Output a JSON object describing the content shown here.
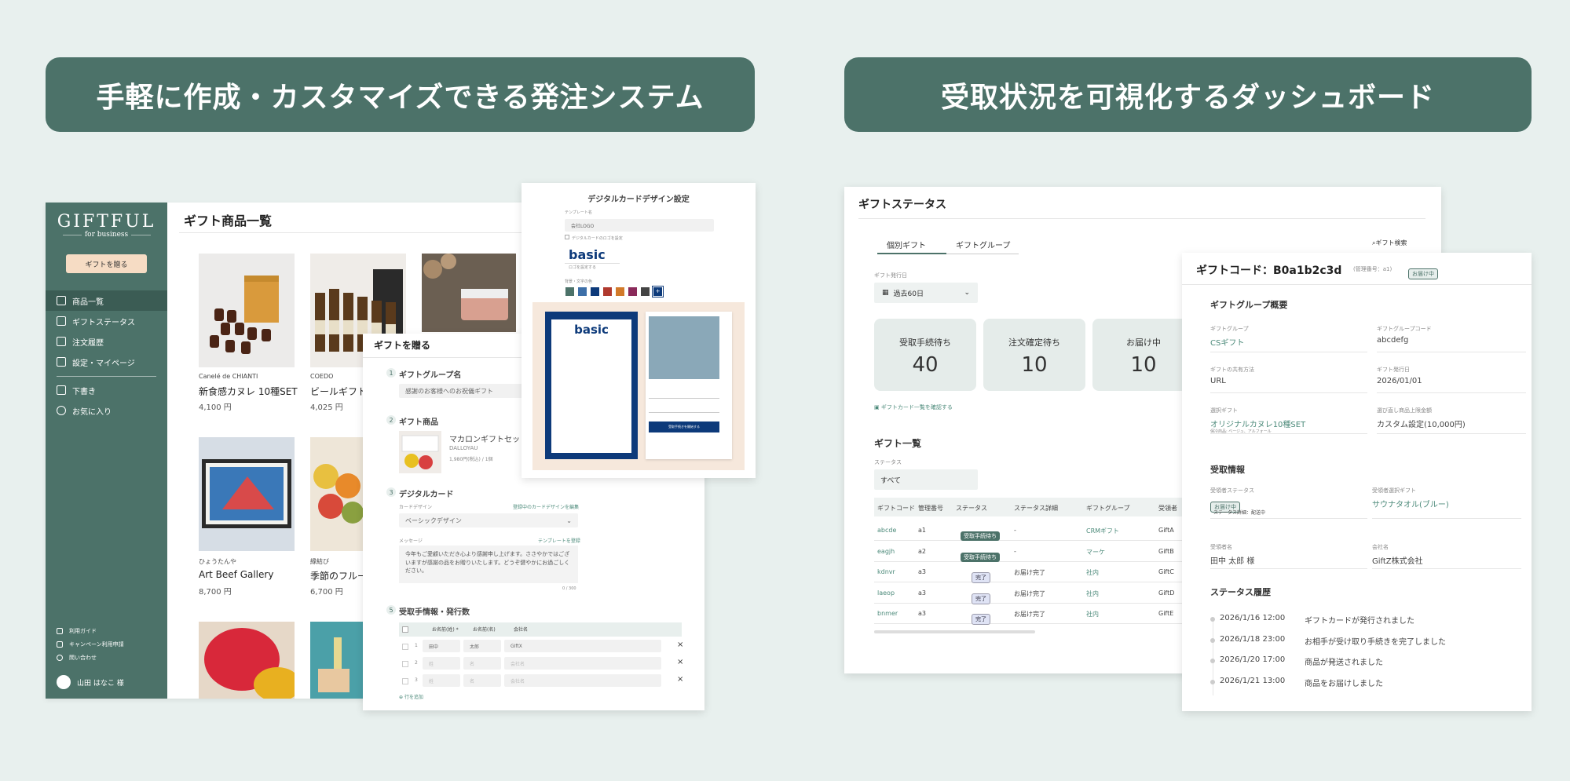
{
  "banners": {
    "left": "手軽に作成・カスタマイズできる発注システム",
    "right": "受取状況を可視化するダッシュボード"
  },
  "sidebar": {
    "logo": "GIFTFUL",
    "logo_sub": "for business",
    "cta": "ギフトを贈る",
    "items": [
      {
        "label": "商品一覧",
        "icon": "gift-icon"
      },
      {
        "label": "ギフトステータス",
        "icon": "truck-icon"
      },
      {
        "label": "注文履歴",
        "icon": "list-icon"
      },
      {
        "label": "設定・マイページ",
        "icon": "settings-icon"
      }
    ],
    "items2": [
      {
        "label": "下書き",
        "icon": "draft-icon"
      },
      {
        "label": "お気に入り",
        "icon": "heart-icon"
      }
    ],
    "footer": [
      "利用ガイド",
      "キャンペーン利用申請",
      "問い合わせ"
    ],
    "user": "山田 はなこ 様"
  },
  "products": {
    "title": "ギフト商品一覧",
    "items": [
      {
        "brand": "Canelé de CHIANTI",
        "name": "新食感カヌレ 10種SET",
        "price": "4,100 円"
      },
      {
        "brand": "COEDO",
        "name": "ビールギフト",
        "price": "4,025 円"
      },
      {
        "brand": "ひょうたんや",
        "name": "Art Beef Gallery",
        "price": "8,700 円"
      },
      {
        "brand": "縁結び",
        "name": "季節のフルー",
        "price": "6,700 円"
      }
    ]
  },
  "order": {
    "title": "ギフトを贈る",
    "step1": "ギフトグループ名",
    "step1_value": "感謝のお客様へのお祝儀ギフト",
    "step2": "ギフト商品",
    "step2_name": "マカロンギフトセット",
    "step2_brand": "DALLOYAU",
    "step2_price": "1,980円(税込) / 1個",
    "step3": "デジタルカード",
    "card_design_label": "カードデザイン",
    "card_design_link": "登録中のカードデザインを編集",
    "card_design_value": "ベーシックデザイン",
    "message_label": "メッセージ",
    "message_link": "テンプレートを登録",
    "message_text": "今年もご愛顧いただき心より感謝申し上げます。ささやかではございますが感謝の品をお贈りいたします。どうぞ健やかにお過ごしください。",
    "message_count": "0 / 300",
    "step5": "受取手情報・発行数",
    "table_headers": [
      "お名前(姓) *",
      "お名前(名)",
      "会社名"
    ],
    "rows": [
      {
        "no": "1",
        "last": "田中",
        "first": "太郎",
        "company": "GIftX"
      },
      {
        "no": "2",
        "last": "姓",
        "first": "名",
        "company": "会社名"
      },
      {
        "no": "3",
        "last": "姓",
        "first": "名",
        "company": "会社名"
      }
    ],
    "add_row": "行を追加"
  },
  "design": {
    "title": "デジタルカードデザイン設定",
    "template_label": "テンプレート名",
    "template_value": "会社LOGO",
    "checkbox": "デジタルカードのロゴを設定",
    "brand_text": "basic",
    "brand_sub": "ロゴを設定する",
    "color_label": "背景・文字の色",
    "swatches": [
      "#4c7269",
      "#3d6fa8",
      "#0d3a7a",
      "#b0392e",
      "#d27a2a",
      "#8a2a5a",
      "#444444",
      "#0d3a7a"
    ],
    "preview_text": "basic",
    "preview_btn": "受取手続きを開始する"
  },
  "status": {
    "title": "ギフトステータス",
    "tabs": [
      "個別ギフト",
      "ギフトグループ"
    ],
    "search": "ギフト検索",
    "date_label": "ギフト発行日",
    "date_value": "過去60日",
    "cards": [
      {
        "label": "受取手続待ち",
        "value": "40"
      },
      {
        "label": "注文確定待ち",
        "value": "10"
      },
      {
        "label": "お届け中",
        "value": "10"
      }
    ],
    "card_link": "ギフトカード一覧を確認する",
    "list_title": "ギフト一覧",
    "filter_label": "ステータス",
    "filter_value": "すべて",
    "headers": [
      "ギフトコード",
      "管理番号",
      "ステータス",
      "ステータス詳細",
      "ギフトグループ",
      "受領者"
    ],
    "rows": [
      {
        "code": "abcde",
        "num": "a1",
        "status": "受取手続待ち",
        "detail": "-",
        "group": "CRMギフト",
        "gift": "GiftA"
      },
      {
        "code": "eagjh",
        "num": "a2",
        "status": "受取手続待ち",
        "detail": "-",
        "group": "マーケ",
        "gift": "GiftB"
      },
      {
        "code": "kdnvr",
        "num": "a3",
        "status": "完了",
        "detail": "お届け完了",
        "group": "社内",
        "gift": "GiftC"
      },
      {
        "code": "laeop",
        "num": "a3",
        "status": "完了",
        "detail": "お届け完了",
        "group": "社内",
        "gift": "GiftD"
      },
      {
        "code": "bnmer",
        "num": "a3",
        "status": "完了",
        "detail": "お届け完了",
        "group": "社内",
        "gift": "GiftE"
      }
    ]
  },
  "detail": {
    "title": "ギフトコード：B0a1b2c3d",
    "mgmt": "(管理番号：a1)",
    "badge": "お届け中",
    "sec1": "ギフトグループ概要",
    "fields": [
      {
        "label": "ギフトグループ",
        "value": "CSギフト",
        "link": true
      },
      {
        "label": "ギフトグループコード",
        "value": "abcdefg",
        "link": false
      },
      {
        "label": "ギフトの共有方法",
        "value": "URL",
        "link": false
      },
      {
        "label": "ギフト発行日",
        "value": "2026/01/01",
        "link": false
      },
      {
        "label": "選択ギフト",
        "value": "オリジナルカヌレ10種SET",
        "link": true
      },
      {
        "label": "選び直し商品上限金額",
        "value": "カスタム設定(10,000円)",
        "link": false
      }
    ],
    "variant": "保冷商品: ベージュ、アルフォール",
    "sec2": "受取情報",
    "receive_status_label": "受領者ステータス",
    "receive_status_badge": "お届け中",
    "receive_status_detail": "ステータス詳細：配送中",
    "chosen_gift_label": "受領者選択ギフト",
    "chosen_gift_value": "サウナタオル(ブルー)",
    "recipient_label": "受領者名",
    "recipient_value": "田中 太郎 様",
    "company_label": "会社名",
    "company_value": "GiftZ株式会社",
    "sec3": "ステータス履歴",
    "history": [
      {
        "time": "2026/1/16 12:00",
        "text": "ギフトカードが発行されました"
      },
      {
        "time": "2026/1/18 23:00",
        "text": "お相手が受け取り手続きを完了しました"
      },
      {
        "time": "2026/1/20 17:00",
        "text": "商品が発送されました"
      },
      {
        "time": "2026/1/21 13:00",
        "text": "商品をお届けしました"
      }
    ]
  }
}
